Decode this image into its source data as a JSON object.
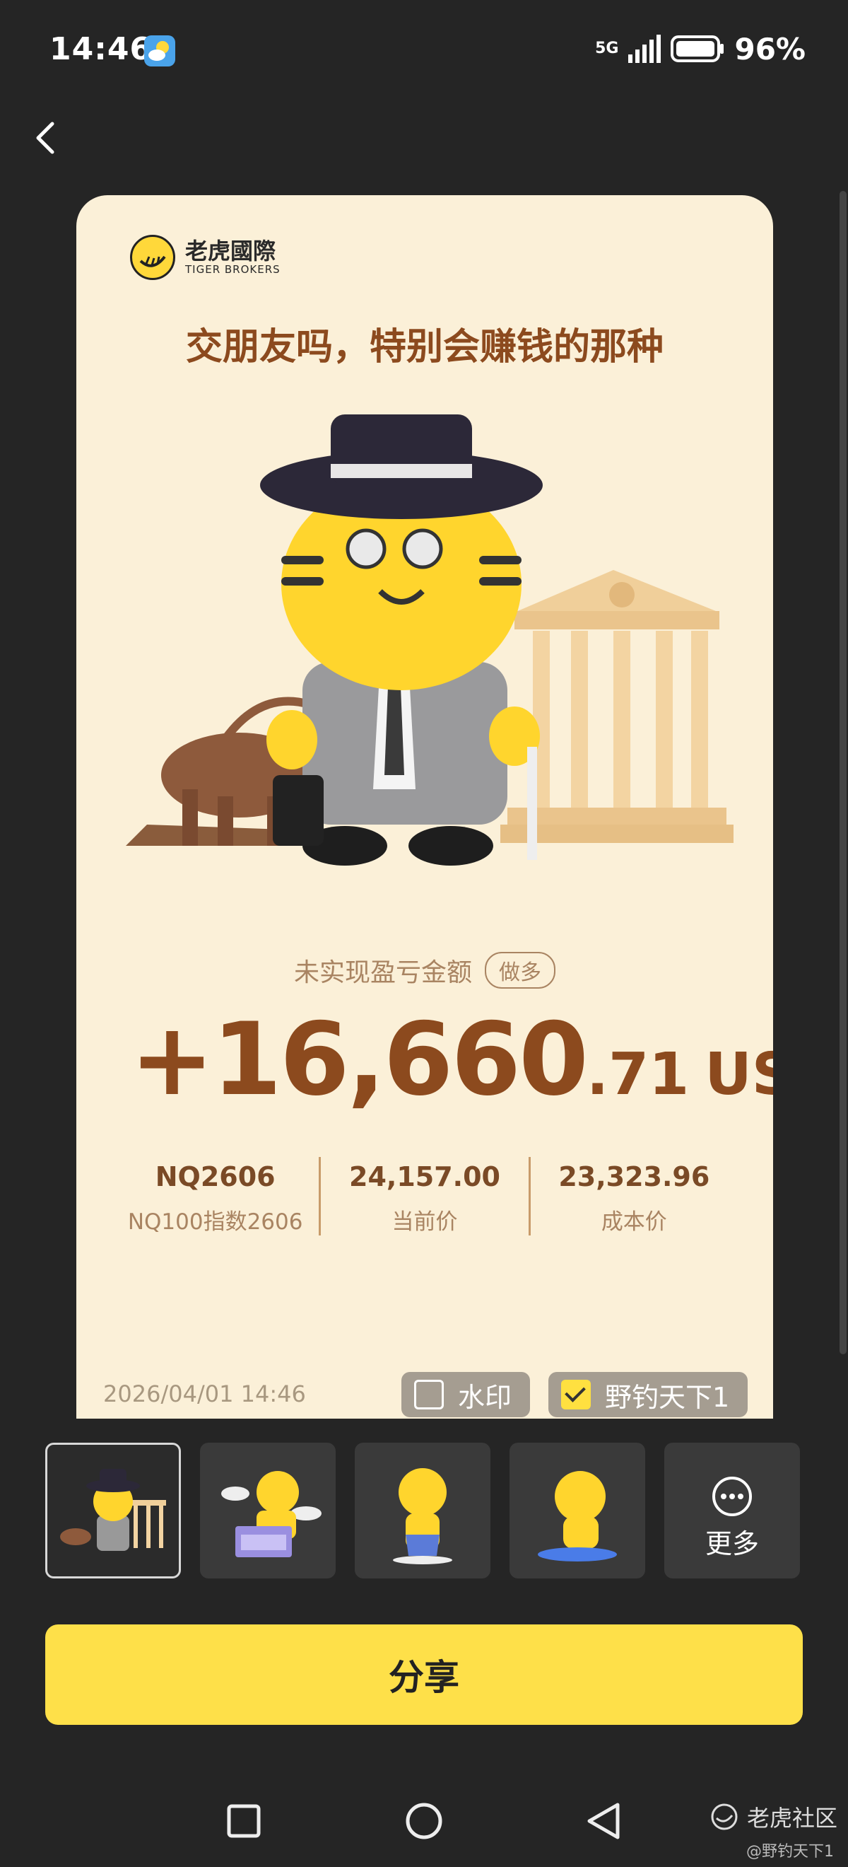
{
  "status_bar": {
    "time": "14:46",
    "network": "5G",
    "battery": "96%",
    "icons": [
      "weather-icon",
      "signal-icon",
      "battery-icon"
    ]
  },
  "nav": {
    "back_icon": "chevron-left-icon"
  },
  "card": {
    "brand_name": "老虎國際",
    "brand_sub": "TIGER BROKERS",
    "title": "交朋友吗，特别会赚钱的那种",
    "pnl_label": "未实现盈亏金额",
    "pnl_tag": "做多",
    "pnl_integer": "+16,660",
    "pnl_decimal": ".71",
    "pnl_currency": "USD",
    "stats": [
      {
        "value": "NQ2606",
        "label": "NQ100指数2606"
      },
      {
        "value": "24,157.00",
        "label": "当前价"
      },
      {
        "value": "23,323.96",
        "label": "成本价"
      }
    ],
    "date": "2026/04/01 14:46",
    "watermark_label": "水印",
    "watermark_checked": false,
    "user_label": "野钓天下1",
    "user_checked": true
  },
  "templates": {
    "items": [
      "tiger-banker",
      "tiger-cloud",
      "tiger-crying",
      "tiger-sad"
    ],
    "selected_index": 0,
    "more_label": "更多"
  },
  "share_button": "分享",
  "system_nav": {
    "icons": [
      "square-icon",
      "circle-icon",
      "triangle-back-icon"
    ]
  },
  "community": {
    "name": "老虎社区",
    "user": "@野钓天下1"
  },
  "colors": {
    "background": "#252525",
    "card": "#fbf0d8",
    "brown": "#8c4a1e",
    "muted": "#a98462",
    "accent_yellow": "#fee049"
  }
}
